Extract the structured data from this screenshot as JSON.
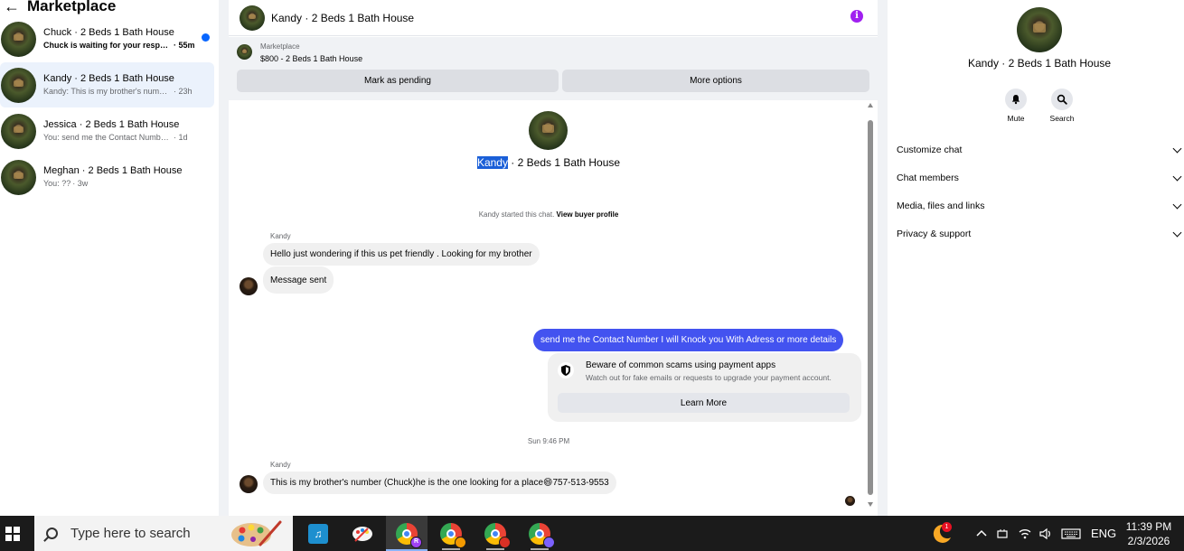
{
  "sidebar": {
    "title": "Marketplace",
    "conversations": [
      {
        "name": "Chuck · 2 Beds 1 Bath House",
        "preview": "Chuck is waiting for your respon...",
        "time": "· 55m"
      },
      {
        "name": "Kandy · 2 Beds 1 Bath House",
        "preview": "Kandy: This is my brother's number (...",
        "time": "· 23h"
      },
      {
        "name": "Jessica · 2 Beds 1 Bath House",
        "preview": "You: send me the Contact Number I w...",
        "time": "· 1d"
      },
      {
        "name": "Meghan · 2 Beds 1 Bath House",
        "preview": "You: ??",
        "time": "· 3w"
      }
    ]
  },
  "chat": {
    "title": "Kandy · 2 Beds 1 Bath House",
    "info_icon": "i",
    "listing": {
      "label": "Marketplace",
      "price_title": "$800 - 2 Beds 1 Bath House"
    },
    "buttons": {
      "pending": "Mark as pending",
      "more": "More options"
    },
    "intro": {
      "highlight": "Kandy",
      "rest": " · 2 Beds 1 Bath House"
    },
    "started": {
      "text": "Kandy started this chat. ",
      "link": "View buyer profile"
    },
    "messages": {
      "sender1": "Kandy",
      "m1": "Hello just wondering if this us pet friendly . Looking for my brother",
      "m2": "Message sent",
      "m3": "send me the Contact Number I will Knock you With Adress or more details",
      "sender2": "Kandy",
      "m4": "This is my brother's number (Chuck)he is the one looking for a place😄757-513-9553"
    },
    "scam": {
      "title": "Beware of common scams using payment apps",
      "subtitle": "Watch out for fake emails or requests to upgrade your payment account.",
      "button": "Learn More"
    },
    "timestamp": "Sun 9:46 PM"
  },
  "right_panel": {
    "name": "Kandy · 2 Beds 1 Bath House",
    "mute": "Mute",
    "search": "Search",
    "sections": [
      "Customize chat",
      "Chat members",
      "Media, files and links",
      "Privacy & support"
    ]
  },
  "taskbar": {
    "search_placeholder": "Type here to search",
    "chrome_badges": [
      "R",
      "",
      "",
      ""
    ],
    "notification_count": "1",
    "language": "ENG",
    "time": "11:39 PM",
    "date": "2/3/2026"
  },
  "colors": {
    "outgoing_bubble": "#4353f0",
    "unread_dot": "#0866ff",
    "info_icon": "#a020f0",
    "active_conversation": "#ebf2fc"
  }
}
